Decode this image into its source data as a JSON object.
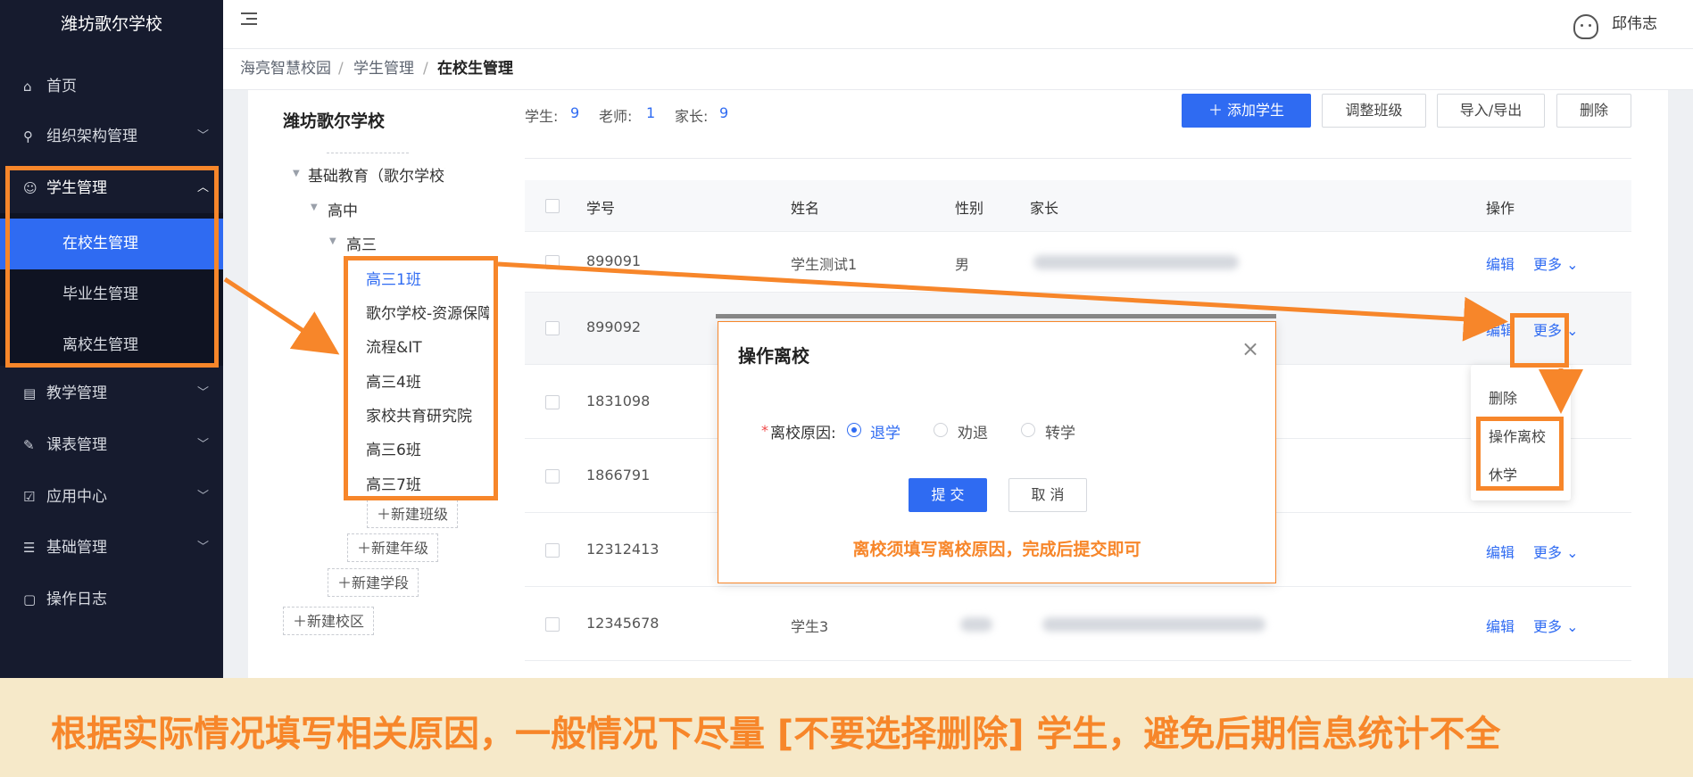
{
  "sidebar": {
    "brand": "潍坊歌尔学校",
    "items": [
      {
        "label": "首页",
        "icon": "home-icon",
        "glyph": "⌂",
        "chevron": false
      },
      {
        "label": "组织架构管理",
        "icon": "org-chart-icon",
        "glyph": "⚲",
        "chevron": true
      },
      {
        "label": "学生管理",
        "icon": "student-icon",
        "glyph": "☺",
        "chevron": true,
        "expanded": true
      },
      {
        "label": "教学管理",
        "icon": "book-icon",
        "glyph": "▤",
        "chevron": true
      },
      {
        "label": "课表管理",
        "icon": "edit-icon",
        "glyph": "✎",
        "chevron": true
      },
      {
        "label": "应用中心",
        "icon": "calendar-icon",
        "glyph": "☑",
        "chevron": true
      },
      {
        "label": "基础管理",
        "icon": "sliders-icon",
        "glyph": "☰",
        "chevron": true
      },
      {
        "label": "操作日志",
        "icon": "log-icon",
        "glyph": "▢",
        "chevron": false
      }
    ],
    "sub_items": [
      {
        "label": "在校生管理",
        "active": true
      },
      {
        "label": "毕业生管理",
        "active": false
      },
      {
        "label": "离校生管理",
        "active": false
      }
    ]
  },
  "header": {
    "user_name": "邱伟志",
    "menu_icon": "menu-fold-icon",
    "avatar_icon": "avatar-icon"
  },
  "breadcrumb": [
    "海亮智慧校园",
    "学生管理",
    "在校生管理"
  ],
  "breadcrumb_separator": "/",
  "tree": {
    "school": "潍坊歌尔学校",
    "nodes": [
      {
        "label": "基础教育（歌尔学校）测试",
        "level": 0,
        "expanded": true
      },
      {
        "label": "高中",
        "level": 1,
        "expanded": true
      },
      {
        "label": "高三",
        "level": 2,
        "expanded": true
      }
    ],
    "classes": [
      "高三1班",
      "歌尔学校-资源保障",
      "流程&IT",
      "高三4班",
      "家校共育研究院",
      "高三6班",
      "高三7班"
    ],
    "selected_class": "高三1班",
    "actions": [
      "＋新建班级",
      "＋新建年级",
      "＋新建学段",
      "＋新建校区"
    ]
  },
  "stats": {
    "student_label": "学生:",
    "student_count": "9",
    "teacher_label": "老师:",
    "teacher_count": "1",
    "parent_label": "家长:",
    "parent_count": "9"
  },
  "toolbar": {
    "add_label": "＋ 添加学生",
    "adjust_label": "调整班级",
    "import_label": "导入/导出",
    "delete_label": "删除"
  },
  "table": {
    "headers": [
      "学号",
      "姓名",
      "性别",
      "家长",
      "操作"
    ],
    "rows": [
      {
        "id": "899091",
        "name": "学生测试1",
        "gender": "男"
      },
      {
        "id": "899092",
        "name": "",
        "gender": ""
      },
      {
        "id": "1831098",
        "name": "",
        "gender": ""
      },
      {
        "id": "1866791",
        "name": "",
        "gender": ""
      },
      {
        "id": "12312413",
        "name": "",
        "gender": ""
      },
      {
        "id": "12345678",
        "name": "学生3",
        "gender": ""
      }
    ],
    "edit_label": "编辑",
    "more_label": "更多 ⌄"
  },
  "dropdown": {
    "items": [
      "删除",
      "操作离校",
      "休学"
    ]
  },
  "modal": {
    "title": "操作离校",
    "close_glyph": "×",
    "field_required": "*",
    "field_label": "离校原因:",
    "options": [
      {
        "label": "退学",
        "checked": true
      },
      {
        "label": "劝退",
        "checked": false
      },
      {
        "label": "转学",
        "checked": false
      }
    ],
    "submit_label": "提 交",
    "cancel_label": "取 消",
    "note": "离校须填写离校原因，完成后提交即可"
  },
  "banner": {
    "text": "根据实际情况填写相关原因，一般情况下尽量 [不要选择删除] 学生，避免后期信息统计不全"
  },
  "colors": {
    "primary": "#2f6bf2",
    "annotation": "#f7862a",
    "sidebar_bg": "#161b2e",
    "banner_bg": "#f6e9c9"
  }
}
